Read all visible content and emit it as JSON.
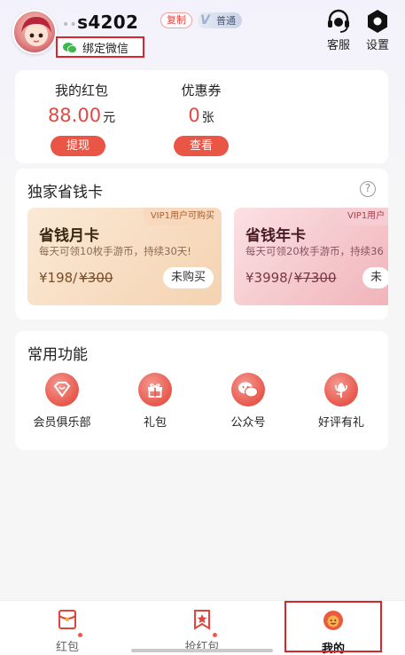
{
  "header": {
    "username": "s4202",
    "copy_label": "复制",
    "vip_level": "普通",
    "bind_wechat_label": "绑定微信",
    "service_label": "客服",
    "settings_label": "设置"
  },
  "wallet": {
    "red_packet_title": "我的红包",
    "red_packet_amount": "88.00",
    "red_packet_unit": "元",
    "withdraw_label": "提现",
    "coupon_title": "优惠券",
    "coupon_count": "0",
    "coupon_unit": "张",
    "view_label": "查看"
  },
  "savings_card": {
    "title": "独家省钱卡",
    "help_label": "?",
    "cards": [
      {
        "tag": "VIP1用户可购买",
        "name": "省钱月卡",
        "desc": "每天可领10枚手游币，持续30天!",
        "price": "¥198/",
        "old_price": "¥300",
        "button": "未购买"
      },
      {
        "tag": "VIP1用户",
        "name": "省钱年卡",
        "desc": "每天可领20枚手游币，持续36",
        "price": "¥3998/",
        "old_price": "¥7300",
        "button": "未"
      }
    ]
  },
  "functions": {
    "title": "常用功能",
    "items": [
      {
        "label": "会员俱乐部",
        "icon": "diamond-heart-icon"
      },
      {
        "label": "礼包",
        "icon": "gift-icon"
      },
      {
        "label": "公众号",
        "icon": "wechat-icon"
      },
      {
        "label": "好评有礼",
        "icon": "flower-icon"
      }
    ]
  },
  "tabbar": {
    "items": [
      {
        "label": "红包",
        "icon": "red-packet-icon"
      },
      {
        "label": "抢红包",
        "icon": "bookmark-star-icon"
      },
      {
        "label": "我的",
        "icon": "profile-face-icon",
        "active": true
      }
    ]
  },
  "colors": {
    "accent": "#ea5646",
    "highlight_frame": "#d9262c"
  }
}
